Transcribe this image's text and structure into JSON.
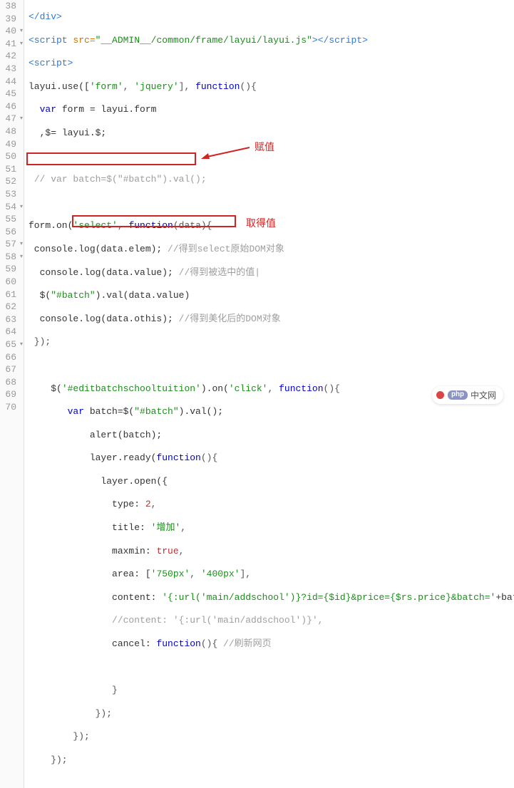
{
  "lines": {
    "38": {
      "gutter": "38",
      "fold": false
    },
    "39": {
      "gutter": "39",
      "fold": false
    },
    "40": {
      "gutter": "40",
      "fold": true
    },
    "41": {
      "gutter": "41",
      "fold": true
    },
    "42": {
      "gutter": "42",
      "fold": false
    },
    "43": {
      "gutter": "43",
      "fold": false
    },
    "44": {
      "gutter": "44",
      "fold": false
    },
    "45": {
      "gutter": "45",
      "fold": false
    },
    "46": {
      "gutter": "46",
      "fold": false
    },
    "47": {
      "gutter": "47",
      "fold": true
    },
    "48": {
      "gutter": "48",
      "fold": false
    },
    "49": {
      "gutter": "49",
      "fold": false
    },
    "50": {
      "gutter": "50",
      "fold": false
    },
    "51": {
      "gutter": "51",
      "fold": false
    },
    "52": {
      "gutter": "52",
      "fold": false
    },
    "53": {
      "gutter": "53",
      "fold": false
    },
    "54": {
      "gutter": "54",
      "fold": true
    },
    "55": {
      "gutter": "55",
      "fold": false
    },
    "56": {
      "gutter": "56",
      "fold": false
    },
    "57": {
      "gutter": "57",
      "fold": true
    },
    "58": {
      "gutter": "58",
      "fold": true
    },
    "59": {
      "gutter": "59",
      "fold": false
    },
    "60": {
      "gutter": "60",
      "fold": false
    },
    "61": {
      "gutter": "61",
      "fold": false
    },
    "62": {
      "gutter": "62",
      "fold": false
    },
    "63": {
      "gutter": "63",
      "fold": false
    },
    "64": {
      "gutter": "64",
      "fold": false
    },
    "65": {
      "gutter": "65",
      "fold": true
    },
    "66": {
      "gutter": "66",
      "fold": false
    },
    "67": {
      "gutter": "67",
      "fold": false
    },
    "68": {
      "gutter": "68",
      "fold": false
    },
    "69": {
      "gutter": "69",
      "fold": false
    },
    "70": {
      "gutter": "70",
      "fold": false
    }
  },
  "tok": {
    "div_close": "</div>",
    "script_open": "<script",
    "script_mid": " src=",
    "script_src": "\"__ADMIN__/common/frame/layui/layui.js\"",
    "script_end1": ">",
    "script_close_tag": "</script>",
    "script_open2": "<script>",
    "layui": "layui",
    "use": ".use([",
    "s_form": "'form'",
    "comma": ", ",
    "s_jquery": "'jquery'",
    "br_close": "], ",
    "func": "function",
    "paren": "(){",
    "var": "var",
    "form": " form = layui.form",
    "dollar_line": ",$= layui.$;",
    "cmt_batch": "// var batch=$(\"#batch\").val();",
    "formon": "form.on(",
    "s_select": "'select'",
    "func_data": "(data){",
    "console": " console.log(data.elem); ",
    "cmt1": "//得到select原始DOM对象",
    "console2": "  console.log(data.value); ",
    "cmt2": "//得到被选中的值|",
    "jq_batch": "  $(",
    "s_hashbatch": "\"#batch\"",
    "val_data": ").val(data.value)",
    "console3": "  console.log(data.othis); ",
    "cmt3": "//得到美化后的DOM对象",
    "close_brace": " });",
    "jq_edit_open": "    $(",
    "s_editbatch": "'#editbatchschooltuition'",
    "on_click": ").on(",
    "s_click": "'click'",
    "func_empty": "(){",
    "var_batch_line": "       var",
    "batch_eq": " batch=$(",
    "batch_val": ").val();",
    "alert_batch": "           alert(batch);",
    "layer_ready": "           layer.ready(",
    "layer_open": "             layer.open({",
    "type_k": "               type: ",
    "type_v": "2",
    "comma_only": ",",
    "title_k": "               title: ",
    "title_v": "'增加'",
    "maxmin_k": "               maxmin: ",
    "true_v": "true",
    "area_k": "               area: [",
    "area_v1": "'750px'",
    "area_v2": "'400px'",
    "area_close": "],",
    "content_k": "               content: ",
    "content_v": "'{:url('main/addschool')}?id={$id}&price={$rs.price}&batch='",
    "content_plus": "+batc",
    "cmt_content": "               //content: '{:url('main/addschool')}',",
    "cancel_k": "               cancel: ",
    "func_open2": "(){ ",
    "cmt_refresh": "//刷新网页",
    "close_b1": "               }",
    "close_b2": "            });",
    "close_b3": "        });",
    "close_b4": "    });"
  },
  "annotations": {
    "assign_label": "赋值",
    "get_label": "取得值"
  },
  "brand": {
    "php": "php",
    "text": "中文网"
  }
}
